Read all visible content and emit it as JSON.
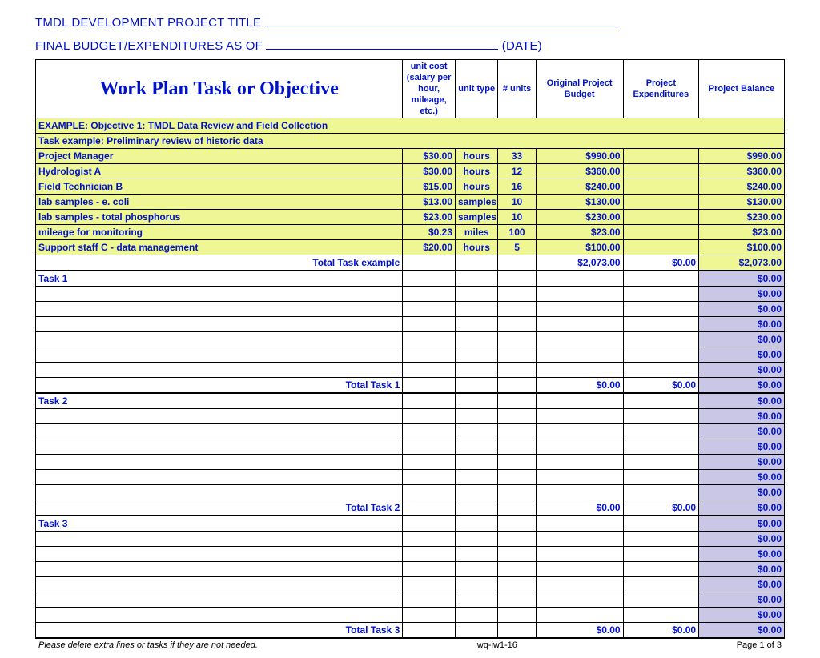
{
  "header": {
    "title_label": "TMDL DEVELOPMENT PROJECT TITLE",
    "budget_label": "FINAL BUDGET/EXPENDITURES AS OF",
    "date_suffix": "(DATE)"
  },
  "columns": {
    "task": "Work Plan Task or Objective",
    "unit_cost": "unit cost (salary per hour, mileage, etc.)",
    "unit_type": "unit type",
    "units": "# units",
    "orig_budget": "Original Project Budget",
    "expenditures": "Project Expenditures",
    "balance": "Project Balance"
  },
  "example": {
    "hdr1": "EXAMPLE: Objective 1: TMDL Data Review and Field Collection",
    "hdr2": "Task example: Preliminary review of historic data",
    "rows": [
      {
        "label": "Project Manager",
        "cost": "$30.00",
        "type": "hours",
        "units": "33",
        "budget": "$990.00",
        "bal": "$990.00"
      },
      {
        "label": "Hydrologist A",
        "cost": "$30.00",
        "type": "hours",
        "units": "12",
        "budget": "$360.00",
        "bal": "$360.00"
      },
      {
        "label": "Field Technician B",
        "cost": "$15.00",
        "type": "hours",
        "units": "16",
        "budget": "$240.00",
        "bal": "$240.00"
      },
      {
        "label": "lab samples - e. coli",
        "cost": "$13.00",
        "type": "samples",
        "units": "10",
        "budget": "$130.00",
        "bal": "$130.00"
      },
      {
        "label": "lab samples - total phosphorus",
        "cost": "$23.00",
        "type": "samples",
        "units": "10",
        "budget": "$230.00",
        "bal": "$230.00"
      },
      {
        "label": "mileage for monitoring",
        "cost": "$0.23",
        "type": "miles",
        "units": "100",
        "budget": "$23.00",
        "bal": "$23.00"
      },
      {
        "label": "Support staff C - data management",
        "cost": "$20.00",
        "type": "hours",
        "units": "5",
        "budget": "$100.00",
        "bal": "$100.00"
      }
    ],
    "total_label": "Total Task example",
    "total_budget": "$2,073.00",
    "total_exp": "$0.00",
    "total_bal": "$2,073.00"
  },
  "tasks": [
    {
      "label": "Task 1",
      "blank_rows": 6,
      "total_label": "Total Task 1",
      "budget": "$0.00",
      "exp": "$0.00",
      "bal": "$0.00"
    },
    {
      "label": "Task 2",
      "blank_rows": 6,
      "total_label": "Total Task 2",
      "budget": "$0.00",
      "exp": "$0.00",
      "bal": "$0.00"
    },
    {
      "label": "Task 3",
      "blank_rows": 6,
      "total_label": "Total Task 3",
      "budget": "$0.00",
      "exp": "$0.00",
      "bal": "$0.00"
    }
  ],
  "zero": "$0.00",
  "footer": {
    "left": "Please delete extra lines or tasks if they are not needed.",
    "mid": "wq-iw1-16",
    "right": "Page 1 of 3"
  }
}
